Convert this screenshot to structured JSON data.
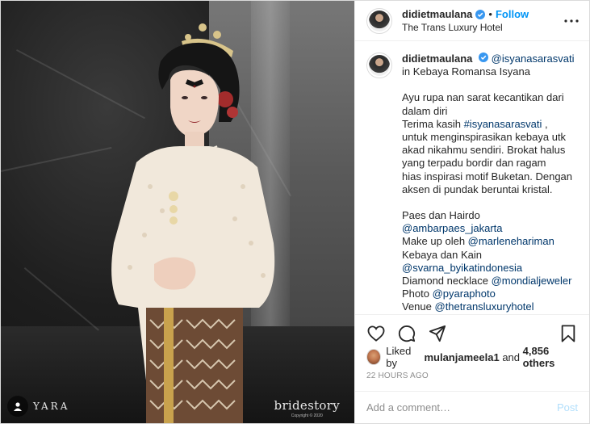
{
  "post": {
    "author": {
      "username": "didietmaulana",
      "verified": true,
      "follow_label": "Follow",
      "location": "The Trans Luxury Hotel"
    },
    "caption": {
      "username": "didietmaulana",
      "tagged": "@isyanasarasvati",
      "lines": [
        "in Kebaya Romansa Isyana",
        "",
        "Ayu rupa nan sarat kecantikan dari",
        "dalam diri",
        "Terima kasih @isyanasarasvati ,",
        "untuk menginspirasikan kebaya utk",
        "akad nikahmu sendiri. Brokat halus",
        "yang terpadu bordir dan ragam",
        "hias inspirasi motif Buketan. Dengan",
        "aksen di pundak beruntai kristal.",
        "",
        "Paes dan Hairdo",
        "@ambarpaes_jakarta",
        "Make up oleh @marlenehariman",
        "Kebaya dan Kain",
        "@svarna_byikatindonesia",
        "Diamond necklace @mondialjeweler",
        "Photo @pyaraphoto",
        "Venue @thetransluxuryhotel"
      ]
    },
    "likes": {
      "prefix": "Liked by",
      "user": "mulanjameela1",
      "middle": "and",
      "others": "4,856 others"
    },
    "timestamp": "22 HOURS AGO",
    "comment_input": {
      "placeholder": "Add a comment…",
      "post_label": "Post"
    },
    "photo": {
      "watermark_left": "YARA",
      "watermark_brand": "bridestory",
      "watermark_copy": "Copyright © 2020"
    },
    "icons": {
      "like": "heart-icon",
      "comment": "comment-icon",
      "share": "share-icon",
      "save": "bookmark-icon",
      "more": "more-options-icon"
    },
    "colors": {
      "link": "#00376b",
      "follow": "#0095f6",
      "verified": "#3897f0",
      "post_disabled": "#b2dffc",
      "secondary_text": "#8e8e8e"
    }
  }
}
